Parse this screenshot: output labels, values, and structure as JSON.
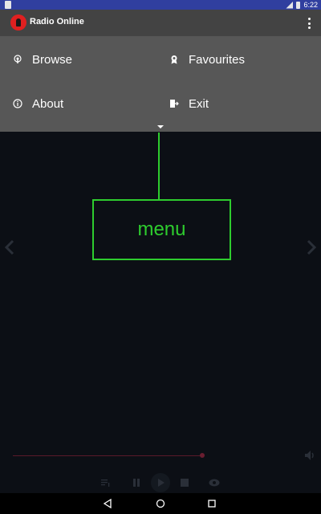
{
  "status_bar": {
    "time": "6:22",
    "icons": [
      "notification-icon",
      "signal-icon",
      "battery-icon"
    ]
  },
  "toolbar": {
    "title": "Radio Online",
    "logo_icon": "microphone-logo-icon",
    "overflow_icon": "more-vert-icon"
  },
  "menu": {
    "items": [
      {
        "label": "Browse",
        "icon": "podcast-icon"
      },
      {
        "label": "Favourites",
        "icon": "award-icon"
      },
      {
        "label": "About",
        "icon": "info-icon"
      },
      {
        "label": "Exit",
        "icon": "exit-door-icon"
      }
    ],
    "expand_icon": "caret-down-icon"
  },
  "annotation": {
    "label": "menu",
    "color": "#2ecc2e"
  },
  "player": {
    "progress": 0.6,
    "controls": [
      "queue-icon",
      "pause-icon",
      "play-icon",
      "stop-icon",
      "eye-icon"
    ],
    "volume_icon": "volume-icon"
  },
  "colors": {
    "status_bar": "#303f9f",
    "toolbar": "#434343",
    "menu_panel": "#575757",
    "background": "#0c0f15",
    "logo": "#e02020"
  }
}
